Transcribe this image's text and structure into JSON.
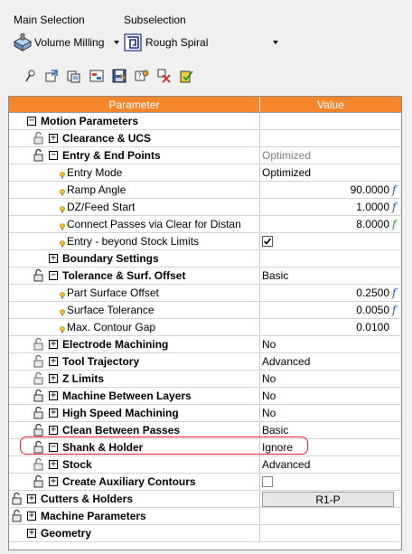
{
  "selection": {
    "main_label": "Main Selection",
    "main_value": "Volume Milling",
    "sub_label": "Subselection",
    "sub_value": "Rough Spiral"
  },
  "toolbar": {
    "icons": [
      "pin-icon",
      "export-icon",
      "copy-icon",
      "parameters-icon",
      "save-icon",
      "help-icon",
      "filter-icon",
      "reset-icon"
    ]
  },
  "grid": {
    "header": {
      "parameter": "Parameter",
      "value": "Value"
    },
    "colors": {
      "header_bg": "#f5862b",
      "fx_blue": "#2050d0",
      "fx_green": "#2aa02a",
      "highlight": "#e0202a"
    },
    "rows": [
      {
        "label": "Motion Parameters",
        "value": ""
      },
      {
        "label": "Clearance & UCS",
        "value": ""
      },
      {
        "label": "Entry & End Points",
        "value": "Optimized"
      },
      {
        "label": "Entry Mode",
        "value": "Optimized"
      },
      {
        "label": "Ramp Angle",
        "value": "90.0000"
      },
      {
        "label": "DZ/Feed Start",
        "value": "1.0000"
      },
      {
        "label": "Connect Passes via Clear for Distan",
        "value": "8.0000"
      },
      {
        "label": "Entry - beyond Stock Limits",
        "value": ""
      },
      {
        "label": "Boundary Settings",
        "value": ""
      },
      {
        "label": "Tolerance & Surf. Offset",
        "value": "Basic"
      },
      {
        "label": "Part Surface Offset",
        "value": "0.2500"
      },
      {
        "label": "Surface Tolerance",
        "value": "0.0050"
      },
      {
        "label": "Max. Contour Gap",
        "value": "0.0100"
      },
      {
        "label": "Electrode Machining",
        "value": "No"
      },
      {
        "label": "Tool Trajectory",
        "value": "Advanced"
      },
      {
        "label": "Z Limits",
        "value": "No"
      },
      {
        "label": "Machine Between Layers",
        "value": "No"
      },
      {
        "label": "High Speed Machining",
        "value": "No"
      },
      {
        "label": "Clean Between Passes",
        "value": "Basic"
      },
      {
        "label": "Shank & Holder",
        "value": "Ignore"
      },
      {
        "label": "Stock",
        "value": "Advanced"
      },
      {
        "label": "Create Auxiliary Contours",
        "value": ""
      },
      {
        "label": "Cutters & Holders",
        "value": "R1-P"
      },
      {
        "label": "Machine Parameters",
        "value": ""
      },
      {
        "label": "Geometry",
        "value": ""
      }
    ]
  }
}
